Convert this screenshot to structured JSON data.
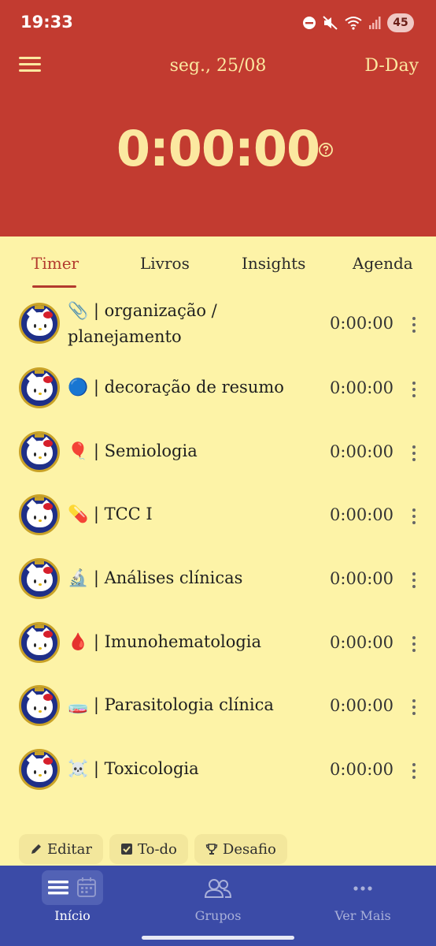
{
  "status_bar": {
    "time": "19:33",
    "battery": "45"
  },
  "header": {
    "date": "seg., 25/08",
    "dday_label": "D-Day",
    "total_timer": "0:00:00"
  },
  "tabs": [
    {
      "label": "Timer",
      "active": true
    },
    {
      "label": "Livros",
      "active": false
    },
    {
      "label": "Insights",
      "active": false
    },
    {
      "label": "Agenda",
      "active": false
    }
  ],
  "subjects": [
    {
      "emoji": "📎",
      "name": "organização / planejamento",
      "time": "0:00:00"
    },
    {
      "emoji": "🔵",
      "name": "decoração de resumo",
      "time": "0:00:00"
    },
    {
      "emoji": "🎈",
      "name": "Semiologia",
      "time": "0:00:00"
    },
    {
      "emoji": "💊",
      "name": "TCC I",
      "time": "0:00:00"
    },
    {
      "emoji": "🔬",
      "name": "Análises clínicas",
      "time": "0:00:00"
    },
    {
      "emoji": "🩸",
      "name": "Imunohematologia",
      "time": "0:00:00"
    },
    {
      "emoji": "🧫",
      "name": "Parasitologia clínica",
      "time": "0:00:00"
    },
    {
      "emoji": "☠️",
      "name": "Toxicologia",
      "time": "0:00:00"
    }
  ],
  "separator": "|",
  "actions": {
    "edit": "Editar",
    "todo": "To-do",
    "challenge": "Desafio"
  },
  "nav": {
    "home": "Início",
    "groups": "Grupos",
    "more": "Ver Mais"
  },
  "colors": {
    "header": "#c23b30",
    "background": "#fdf3a7",
    "nav": "#3b4ba7",
    "accent": "#b33a2e"
  }
}
